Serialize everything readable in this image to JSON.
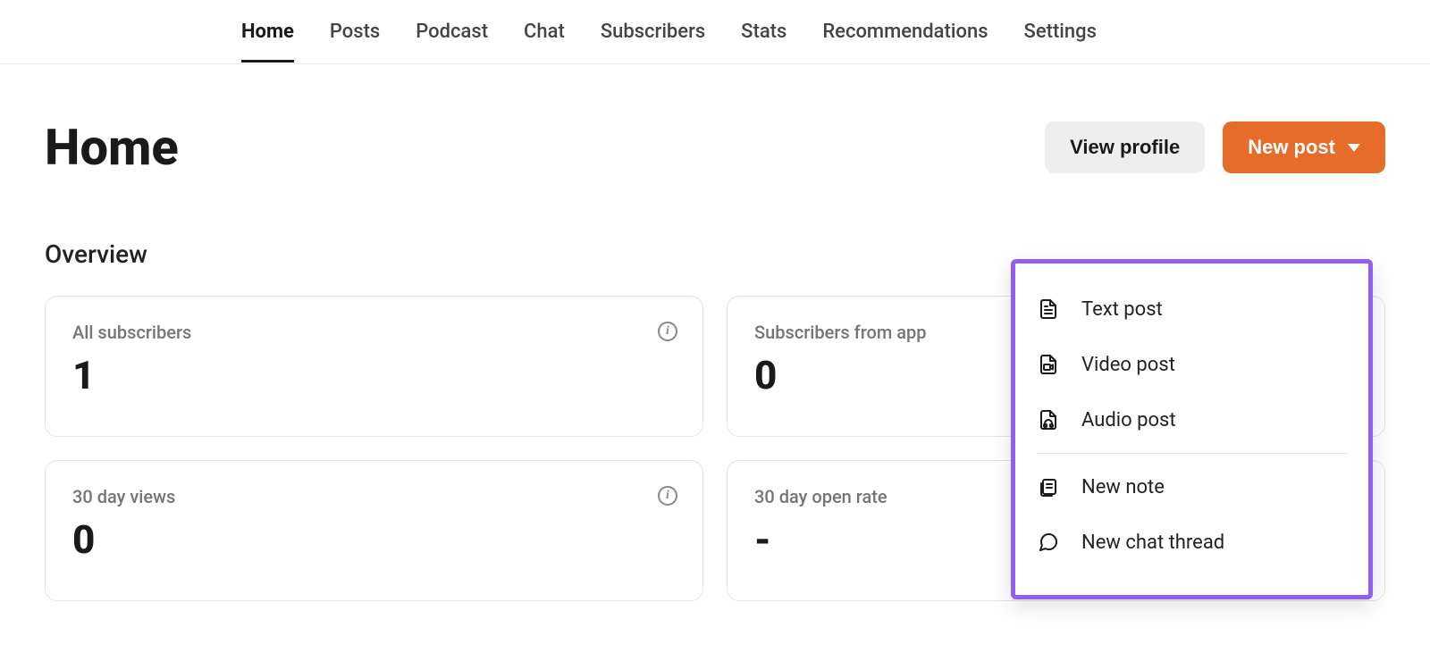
{
  "nav": {
    "items": [
      {
        "label": "Home",
        "active": true
      },
      {
        "label": "Posts",
        "active": false
      },
      {
        "label": "Podcast",
        "active": false
      },
      {
        "label": "Chat",
        "active": false
      },
      {
        "label": "Subscribers",
        "active": false
      },
      {
        "label": "Stats",
        "active": false
      },
      {
        "label": "Recommendations",
        "active": false
      },
      {
        "label": "Settings",
        "active": false
      }
    ]
  },
  "header": {
    "title": "Home",
    "view_profile_label": "View profile",
    "new_post_label": "New post"
  },
  "overview": {
    "section_title": "Overview",
    "cards": [
      {
        "label": "All subscribers",
        "value": "1",
        "info": true
      },
      {
        "label": "Subscribers from app",
        "value": "0",
        "info": false
      },
      {
        "label": "30 day views",
        "value": "0",
        "info": true
      },
      {
        "label": "30 day open rate",
        "value": "-",
        "info": false
      }
    ]
  },
  "dropdown": {
    "items": [
      {
        "label": "Text post",
        "icon": "text-post-icon"
      },
      {
        "label": "Video post",
        "icon": "video-post-icon"
      },
      {
        "label": "Audio post",
        "icon": "audio-post-icon"
      },
      {
        "label": "New note",
        "icon": "note-icon"
      },
      {
        "label": "New chat thread",
        "icon": "chat-icon"
      }
    ]
  }
}
